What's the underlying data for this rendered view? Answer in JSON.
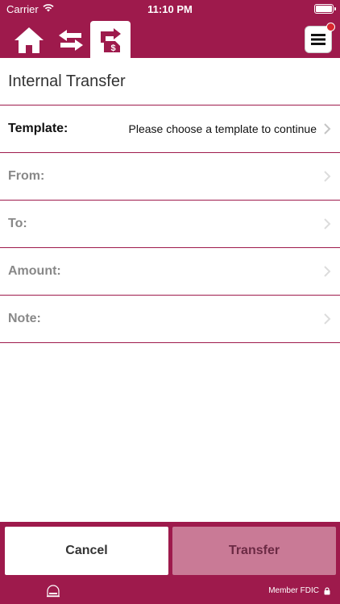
{
  "status_bar": {
    "carrier": "Carrier",
    "time": "11:10 PM"
  },
  "nav": {
    "icons": [
      "home-icon",
      "transfer-arrows-icon",
      "internal-transfer-icon",
      "menu-icon"
    ],
    "active_tab": "internal-transfer",
    "menu_has_notification": true
  },
  "page": {
    "title": "Internal Transfer"
  },
  "form": {
    "template_label": "Template:",
    "template_value": "Please choose a template to continue",
    "from_label": "From:",
    "to_label": "To:",
    "amount_label": "Amount:",
    "note_label": "Note:"
  },
  "actions": {
    "cancel_label": "Cancel",
    "transfer_label": "Transfer"
  },
  "footer": {
    "fdic_text": "Member FDIC"
  },
  "colors": {
    "brand": "#9e1a4c",
    "transfer_disabled": "#c97a96",
    "notification": "#d9272e"
  }
}
